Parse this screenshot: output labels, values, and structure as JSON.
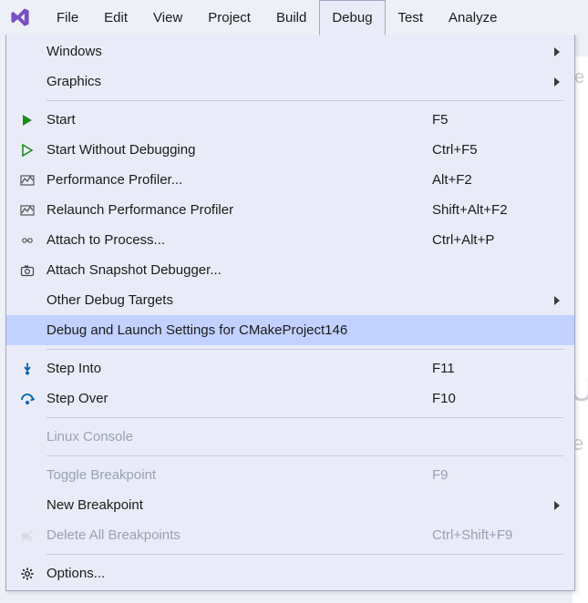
{
  "menubar": {
    "items": [
      {
        "label": "File"
      },
      {
        "label": "Edit"
      },
      {
        "label": "View"
      },
      {
        "label": "Project"
      },
      {
        "label": "Build"
      },
      {
        "label": "Debug"
      },
      {
        "label": "Test"
      },
      {
        "label": "Analyze"
      }
    ],
    "open_index": 5
  },
  "dropdown": {
    "items": [
      {
        "type": "item",
        "icon": "none",
        "label": "Windows",
        "shortcut": "",
        "submenu": true
      },
      {
        "type": "item",
        "icon": "none",
        "label": "Graphics",
        "shortcut": "",
        "submenu": true
      },
      {
        "type": "sep"
      },
      {
        "type": "item",
        "icon": "start",
        "label": "Start",
        "shortcut": "F5"
      },
      {
        "type": "item",
        "icon": "start-outline",
        "label": "Start Without Debugging",
        "shortcut": "Ctrl+F5"
      },
      {
        "type": "item",
        "icon": "perf",
        "label": "Performance Profiler...",
        "shortcut": "Alt+F2"
      },
      {
        "type": "item",
        "icon": "perf",
        "label": "Relaunch Performance Profiler",
        "shortcut": "Shift+Alt+F2"
      },
      {
        "type": "item",
        "icon": "attach",
        "label": "Attach to Process...",
        "shortcut": "Ctrl+Alt+P"
      },
      {
        "type": "item",
        "icon": "snapshot",
        "label": "Attach Snapshot Debugger..."
      },
      {
        "type": "item",
        "icon": "none",
        "label": "Other Debug Targets",
        "shortcut": "",
        "submenu": true
      },
      {
        "type": "item",
        "icon": "none",
        "label": "Debug and Launch Settings for CMakeProject146",
        "shortcut": "",
        "highlight": true
      },
      {
        "type": "sep"
      },
      {
        "type": "item",
        "icon": "step-into",
        "label": "Step Into",
        "shortcut": "F11"
      },
      {
        "type": "item",
        "icon": "step-over",
        "label": "Step Over",
        "shortcut": "F10"
      },
      {
        "type": "sep"
      },
      {
        "type": "item",
        "icon": "none",
        "label": "Linux Console",
        "shortcut": "",
        "disabled": true
      },
      {
        "type": "sep"
      },
      {
        "type": "item",
        "icon": "none",
        "label": "Toggle Breakpoint",
        "shortcut": "F9",
        "disabled": true
      },
      {
        "type": "item",
        "icon": "none",
        "label": "New Breakpoint",
        "shortcut": "",
        "submenu": true
      },
      {
        "type": "item",
        "icon": "del-bp",
        "label": "Delete All Breakpoints",
        "shortcut": "Ctrl+Shift+F9",
        "disabled": true
      },
      {
        "type": "sep"
      },
      {
        "type": "item",
        "icon": "gear",
        "label": "Options..."
      }
    ]
  }
}
